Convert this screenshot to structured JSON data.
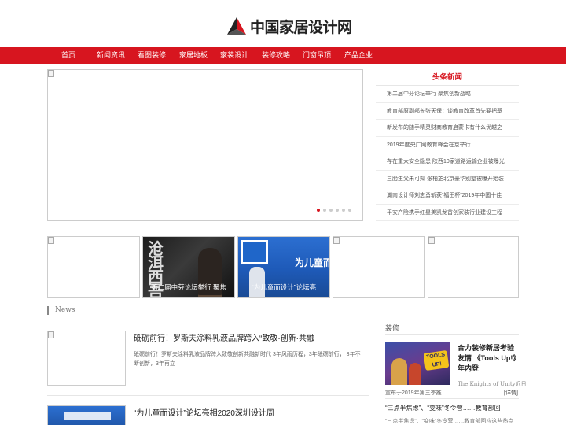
{
  "site": {
    "logo_text": "中国家居设计网"
  },
  "nav": {
    "items": [
      "首页",
      "新闻资讯",
      "看图装修",
      "家居地板",
      "家装设计",
      "装修攻略",
      "门窗吊顶",
      "产品企业"
    ]
  },
  "headlines": {
    "title": "头条新闻",
    "items": [
      "第二届中芬论坛举行 聚焦创新战略",
      "教育部原副部长张天保：谈教育改革首先要把基",
      "新发布的随手精灵财商教育启蒙卡有什么优越之",
      "2019年度央广网教育峰会在京举行",
      "存在重大安全隐患 陕西10家道路运输企业被曝光",
      "三胎生父未可知 张柏芝北京豪华别墅被曝开始装",
      "湖南设计师刘志勇斩获“福田杯”2019年中国十佳",
      "平安产险携手红星美凯龙首创家装行业建设工程"
    ]
  },
  "thumbs": {
    "captions": [
      "",
      "第二届中芬论坛举行 聚焦",
      "“为儿童而设计”论坛亮",
      "",
      ""
    ],
    "overlay_brush": "沧洱西吾有",
    "overlay_banner": "为儿童而设计"
  },
  "news": {
    "heading": "News",
    "items": [
      {
        "title": "砥砺前行！罗斯夫涂料乳液品牌跨入“致敬·创新·共融",
        "summary": "砥砺前行！罗斯夫涂料乳液品牌跨入致敬创新共融新时代 3年风雨历程，3年砥砺前行， 3年不断创新，3年再立"
      },
      {
        "title": "“为儿童而设计”论坛亮相2020深圳设计周",
        "summary": ""
      }
    ]
  },
  "side": {
    "heading": "装修",
    "feature_title": "合力装修新居考验友情 《Tools Up!》年内登",
    "feature_author": "The Knights of Unity近日",
    "feature_date": "宣布于2019年第三季推",
    "more": "[详情]",
    "badge": "TOOLS UP!",
    "item2_title": "“三点半焦虑”、“变味”冬令营……教育部回",
    "item2_summary": "“三点半焦虑”、“变味”冬令营……教育部回应这些热点"
  },
  "colors": {
    "accent": "#d7151f"
  }
}
